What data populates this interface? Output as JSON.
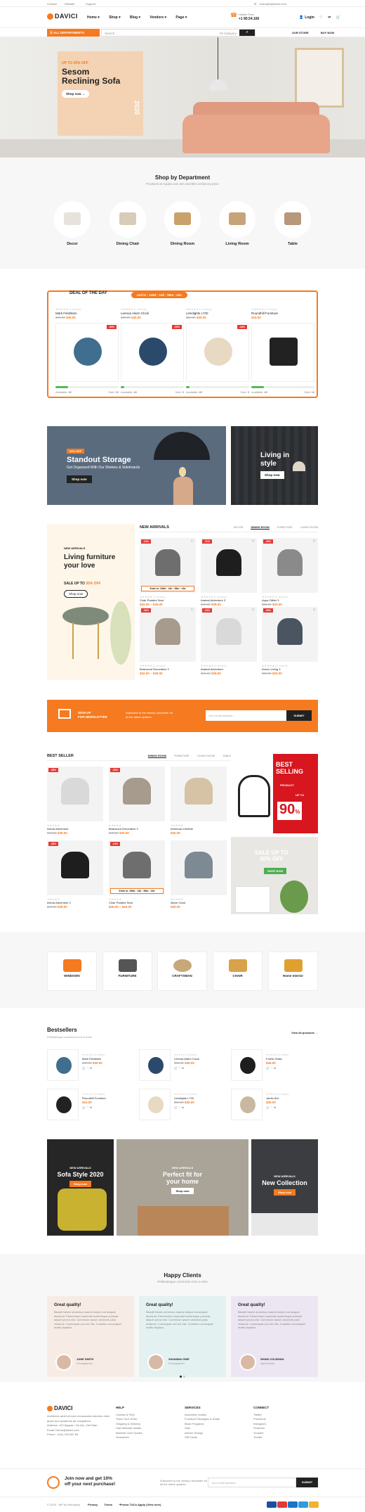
{
  "topbar": {
    "links": [
      "Contact",
      "Website",
      "Support"
    ],
    "email": "example@davici.com"
  },
  "header": {
    "logo": "DAVICI",
    "nav": [
      "Home ▾",
      "Shop ▾",
      "Blog ▾",
      "Vendors ▾",
      "Page ▾"
    ],
    "hotline_label": "Hotline Free",
    "hotline_number": "+1 80.54.166",
    "login": "Login"
  },
  "catbar": {
    "all_departments": "ALL DEPARTMENTS",
    "search_placeholder": "Search...",
    "search_category": "All Category",
    "links": [
      "OUR STORE",
      "BUY NOW"
    ]
  },
  "hero": {
    "offer": "UP TO 30% OFF",
    "title_line1": "Sesom",
    "title_line2": "Reclining Sofa",
    "button": "Shop now →",
    "year": "2020"
  },
  "departments": {
    "title": "Shop by Department",
    "subtitle": "Products at Aquila.com are excellent at factory price",
    "items": [
      {
        "label": "Decor",
        "color": "#e7e3dc"
      },
      {
        "label": "Dining Chair",
        "color": "#d8cbb8"
      },
      {
        "label": "Dining Room",
        "color": "#c9a16a"
      },
      {
        "label": "Living Room",
        "color": "#c7a478"
      },
      {
        "label": "Table",
        "color": "#b8977a"
      }
    ]
  },
  "deal": {
    "title": "DEAL OF THE DAY",
    "timer": "end in : 146d : 14h : 58m : 44s",
    "products": [
      {
        "stars": "★★★★★ (1 review)",
        "name": "Mark Fieldstein",
        "old": "$40.00",
        "new": "$30.00",
        "sale": "-50%",
        "available_label": "Available:",
        "available": "40",
        "sold_label": "Sold:",
        "sold": "10",
        "fill": 0.2,
        "color": "#3f6e8e"
      },
      {
        "stars": "★★★★★ (1 review)",
        "name": "Leenoa Alarm Clock",
        "old": "$60.00",
        "new": "$40.00",
        "sale": "-33%",
        "available_label": "Available:",
        "available": "40",
        "sold_label": "Sold:",
        "sold": "0",
        "fill": 0.05,
        "color": "#2b4a6b"
      },
      {
        "stars": "★★★★★ (1 review)",
        "name": "Limelights L720",
        "old": "$54.00",
        "new": "$30.00",
        "sale": "-44%",
        "available_label": "Available:",
        "available": "40",
        "sold_label": "Sold:",
        "sold": "0",
        "fill": 0.05,
        "color": "#e8d9c2"
      },
      {
        "stars": "★★★★★ (1 review)",
        "name": "Roundhill Furniture",
        "old": "",
        "new": "$15.00",
        "sale": "",
        "available_label": "Available:",
        "available": "40",
        "sold_label": "Sold:",
        "sold": "10",
        "fill": 0.2,
        "color": "#222222"
      }
    ]
  },
  "banners": {
    "b1_tag": "20% OFF",
    "b1_title": "Standout Storage",
    "b1_sub": "Get Organized With Our Shelves & Sideboards",
    "b1_btn": "Shop now",
    "b2_title_line1": "Living in",
    "b2_title_line2": "style",
    "b2_btn": "Shop now"
  },
  "new_arrivals": {
    "promo_small": "NEW ARRIVALS",
    "promo_title_line1": "Living furniture",
    "promo_title_line2": "your love",
    "promo_sale": "SALE UP TO",
    "promo_sale_pct": "30% OFF",
    "promo_btn": "Shop now",
    "title": "NEW ARRIVALS",
    "tabs": [
      "DECOR",
      "DINING ROOM",
      "FURNITURE",
      "LIVING ROOM"
    ],
    "active_tab": "DINING ROOM",
    "timer": "Ends in: 256d : 14h : 58m : 43s",
    "products": [
      {
        "name": "Chair Padded Seat",
        "price": "$32.00 – $35.00",
        "sale": "-24%",
        "color": "#6e6e6e"
      },
      {
        "name": "Arateal Adventure 3",
        "price": "$29.00",
        "old": "$40.00",
        "sale": "-11%",
        "color": "#1e1e1e"
      },
      {
        "name": "Aqua Glitter 3",
        "price": "$20.00",
        "old": "$33.00",
        "sale": "-28%",
        "color": "#8a8a8a"
      },
      {
        "name": "Briarwood Decorative 3",
        "price": "$32.00 – $36.00",
        "sale": "-26%",
        "color": "#a69b8d"
      },
      {
        "name": "Arateal Adventure",
        "price": "$29.00",
        "old": "$40.00",
        "sale": "-24%",
        "color": "#d9d9d9"
      },
      {
        "name": "Annon Living 3",
        "price": "$20.00",
        "old": "$33.00",
        "sale": "-28%",
        "color": "#4a5561"
      }
    ]
  },
  "newsletter": {
    "title_line1": "SIGN UP",
    "title_line2": "FOR NEWSLETTER",
    "desc": "Subscribe to the weekly newsletter for all the latest updates",
    "placeholder": "Your email address...",
    "button": "SUBMIT"
  },
  "best_seller": {
    "title": "BEST SELLER",
    "tabs": [
      "DINING ROOM",
      "FURNITURE",
      "LIVING ROOM",
      "TABLE"
    ],
    "active_tab": "DINING ROOM",
    "timer": "Ends in: 256d : 14h : 58m : 43s",
    "products": [
      {
        "name": "Arrival Adventure",
        "price": "$29.00",
        "old": "$40.00",
        "sale": "-38%",
        "color": "#d9d9d9"
      },
      {
        "name": "Briarwood Decorative 3",
        "price": "$29.00",
        "old": "$40.00",
        "sale": "-29%",
        "color": "#a69b8d"
      },
      {
        "name": "American Lifetime",
        "price": "$20.00",
        "old": "",
        "sale": "",
        "color": "#d6c3a5"
      },
      {
        "name": "Arrival Adventure 2",
        "price": "$29.00",
        "old": "$40.00",
        "sale": "-38%",
        "color": "#1e1e1e"
      },
      {
        "name": "Chair Padded Seat",
        "price": "$40.00 – $42.00",
        "sale": "-24%",
        "color": "#6e6e6e"
      },
      {
        "name": "Allure Clock",
        "price": "$20.00",
        "old": "",
        "sale": "",
        "color": "#7d8a93"
      }
    ],
    "ad1_line1": "BEST",
    "ad1_line2": "SELLING",
    "ad1_small": "PRODUCT",
    "ad1_upto": "UP TO",
    "ad1_pct": "90",
    "ad2_line1": "SALE UP TO",
    "ad2_line2": "30% OFF",
    "ad2_btn": "SHOP NOW"
  },
  "brands": [
    {
      "name": "WINDOWS",
      "color": "#f57a20"
    },
    {
      "name": "FURNITURE",
      "color": "#555555"
    },
    {
      "name": "CRAFTSMAN",
      "color": "#c8a77a"
    },
    {
      "name": "CHAIR",
      "color": "#d8a24a"
    },
    {
      "name": "Home Interior",
      "color": "#e0a030"
    }
  ],
  "bestsellers": {
    "title": "Bestsellers",
    "subtitle": "Pellentesque commodo eros a enim",
    "view_all": "View all products →",
    "items": [
      {
        "name": "Mark Fieldstein",
        "old": "$40.00",
        "new": "$30.00",
        "color": "#3f6e8e"
      },
      {
        "name": "Leenoa Alarm Clock",
        "old": "$60.00",
        "new": "$40.00",
        "color": "#2b4a6b"
      },
      {
        "name": "Forest Glass",
        "old": "",
        "new": "$45.00",
        "color": "#1e1e1e"
      },
      {
        "name": "Roundhill Furniture",
        "old": "",
        "new": "$15.00",
        "color": "#222222"
      },
      {
        "name": "Limelights L720",
        "old": "$54.00",
        "new": "$30.00",
        "color": "#e8d9c2"
      },
      {
        "name": "Jardin 8x2",
        "old": "",
        "new": "$30.00",
        "color": "#c8b8a0"
      }
    ]
  },
  "promos": {
    "p1_small": "NEW ARRIVALS",
    "p1_title": "Sofa Style 2020",
    "p1_btn": "Shop now",
    "p2_small": "NEW ARRIVALS",
    "p2_title_line1": "Perfect fit for",
    "p2_title_line2": "your home",
    "p2_btn": "Shop now",
    "p3_small": "NEW ARRIVALS",
    "p3_title": "New Collection",
    "p3_btn": "Shop now"
  },
  "clients": {
    "title": "Happy Clients",
    "subtitle": "Pellentesque commodo eros a enim",
    "items": [
      {
        "quote": "Great quality!",
        "text": "Blandit fames senectus mauris tempor consequat tincidunt. Elementum imperdiet scelerisque pulvinar aliquet purus nisi. Commodo ipsum dictumst justo vivamus. Consequat orci dui nisi. Curabitur consequat mollis dapibus.",
        "name": "JANE SMITH",
        "role": "Photographer",
        "bg": "#f7ece5"
      },
      {
        "quote": "Great quality!",
        "text": "Blandit fames senectus mauris tempor consequat tincidunt. Elementum imperdiet scelerisque pulvinar aliquet purus nisi. Commodo ipsum dictumst justo vivamus. Consequat orci dui nisi. Curabitur consequat mollis dapibus.",
        "name": "SAVANNA OWE",
        "role": "Photographer",
        "bg": "#e4f1f1"
      },
      {
        "quote": "Great quality!",
        "text": "Blandit fames senectus mauris tempor consequat tincidunt. Elementum imperdiet scelerisque pulvinar aliquet purus nisi. Commodo ipsum dictumst justo vivamus. Consequat orci dui nisi. Curabitur consequat mollis dapibus.",
        "name": "SHAW COLEMAN",
        "role": "Agriculturist",
        "bg": "#ece6f3"
      }
    ]
  },
  "footer": {
    "logo": "DAVICI",
    "about": "Architecto amet sit nam recusandae dolorem dolor quam quo possimus ab voluptatem.",
    "address": "Address: 123 Nguyen, Ha Noi, Viet Nam",
    "email": "Email: Demo@davici.com",
    "phone": "Phone: +(01) 234 567 89",
    "col1_title": "HELP",
    "col1": [
      "Contact & FAQ",
      "Track Your Order",
      "Shipping & Delivery",
      "Visit Website Details",
      "Material Care Guides",
      "Guarantee"
    ],
    "col2_title": "SERVICES",
    "col2": [
      "Assembly Guides",
      "Furniture Packages & Deals",
      "Book Programs",
      "Sale",
      "Interior Design",
      "Gift Cards"
    ],
    "col3_title": "CONNECT",
    "col3": [
      "Twitter",
      "Facebook",
      "Instagram",
      "Pinterest",
      "Youtube",
      "Tumblr"
    ]
  },
  "promo_bar": {
    "title_line1": "Join now and get 10%",
    "title_line2": "off your next purchase!",
    "desc": "Subscribe to the weekly newsletter for all the latest updates",
    "placeholder": "Your email address...",
    "button": "SUBMIT"
  },
  "copyright": {
    "text": "© 2020 - WP by Wordsaxy",
    "links": [
      "Privacy",
      "Terms",
      "*Promo T&Cs Apply (View here)"
    ],
    "payments": [
      {
        "name": "visa",
        "color": "#1a4fa0"
      },
      {
        "name": "mastercard",
        "color": "#e53935"
      },
      {
        "name": "paypal",
        "color": "#1b74c5"
      },
      {
        "name": "amex",
        "color": "#2d9cdb"
      },
      {
        "name": "discover",
        "color": "#f2b134"
      }
    ]
  }
}
